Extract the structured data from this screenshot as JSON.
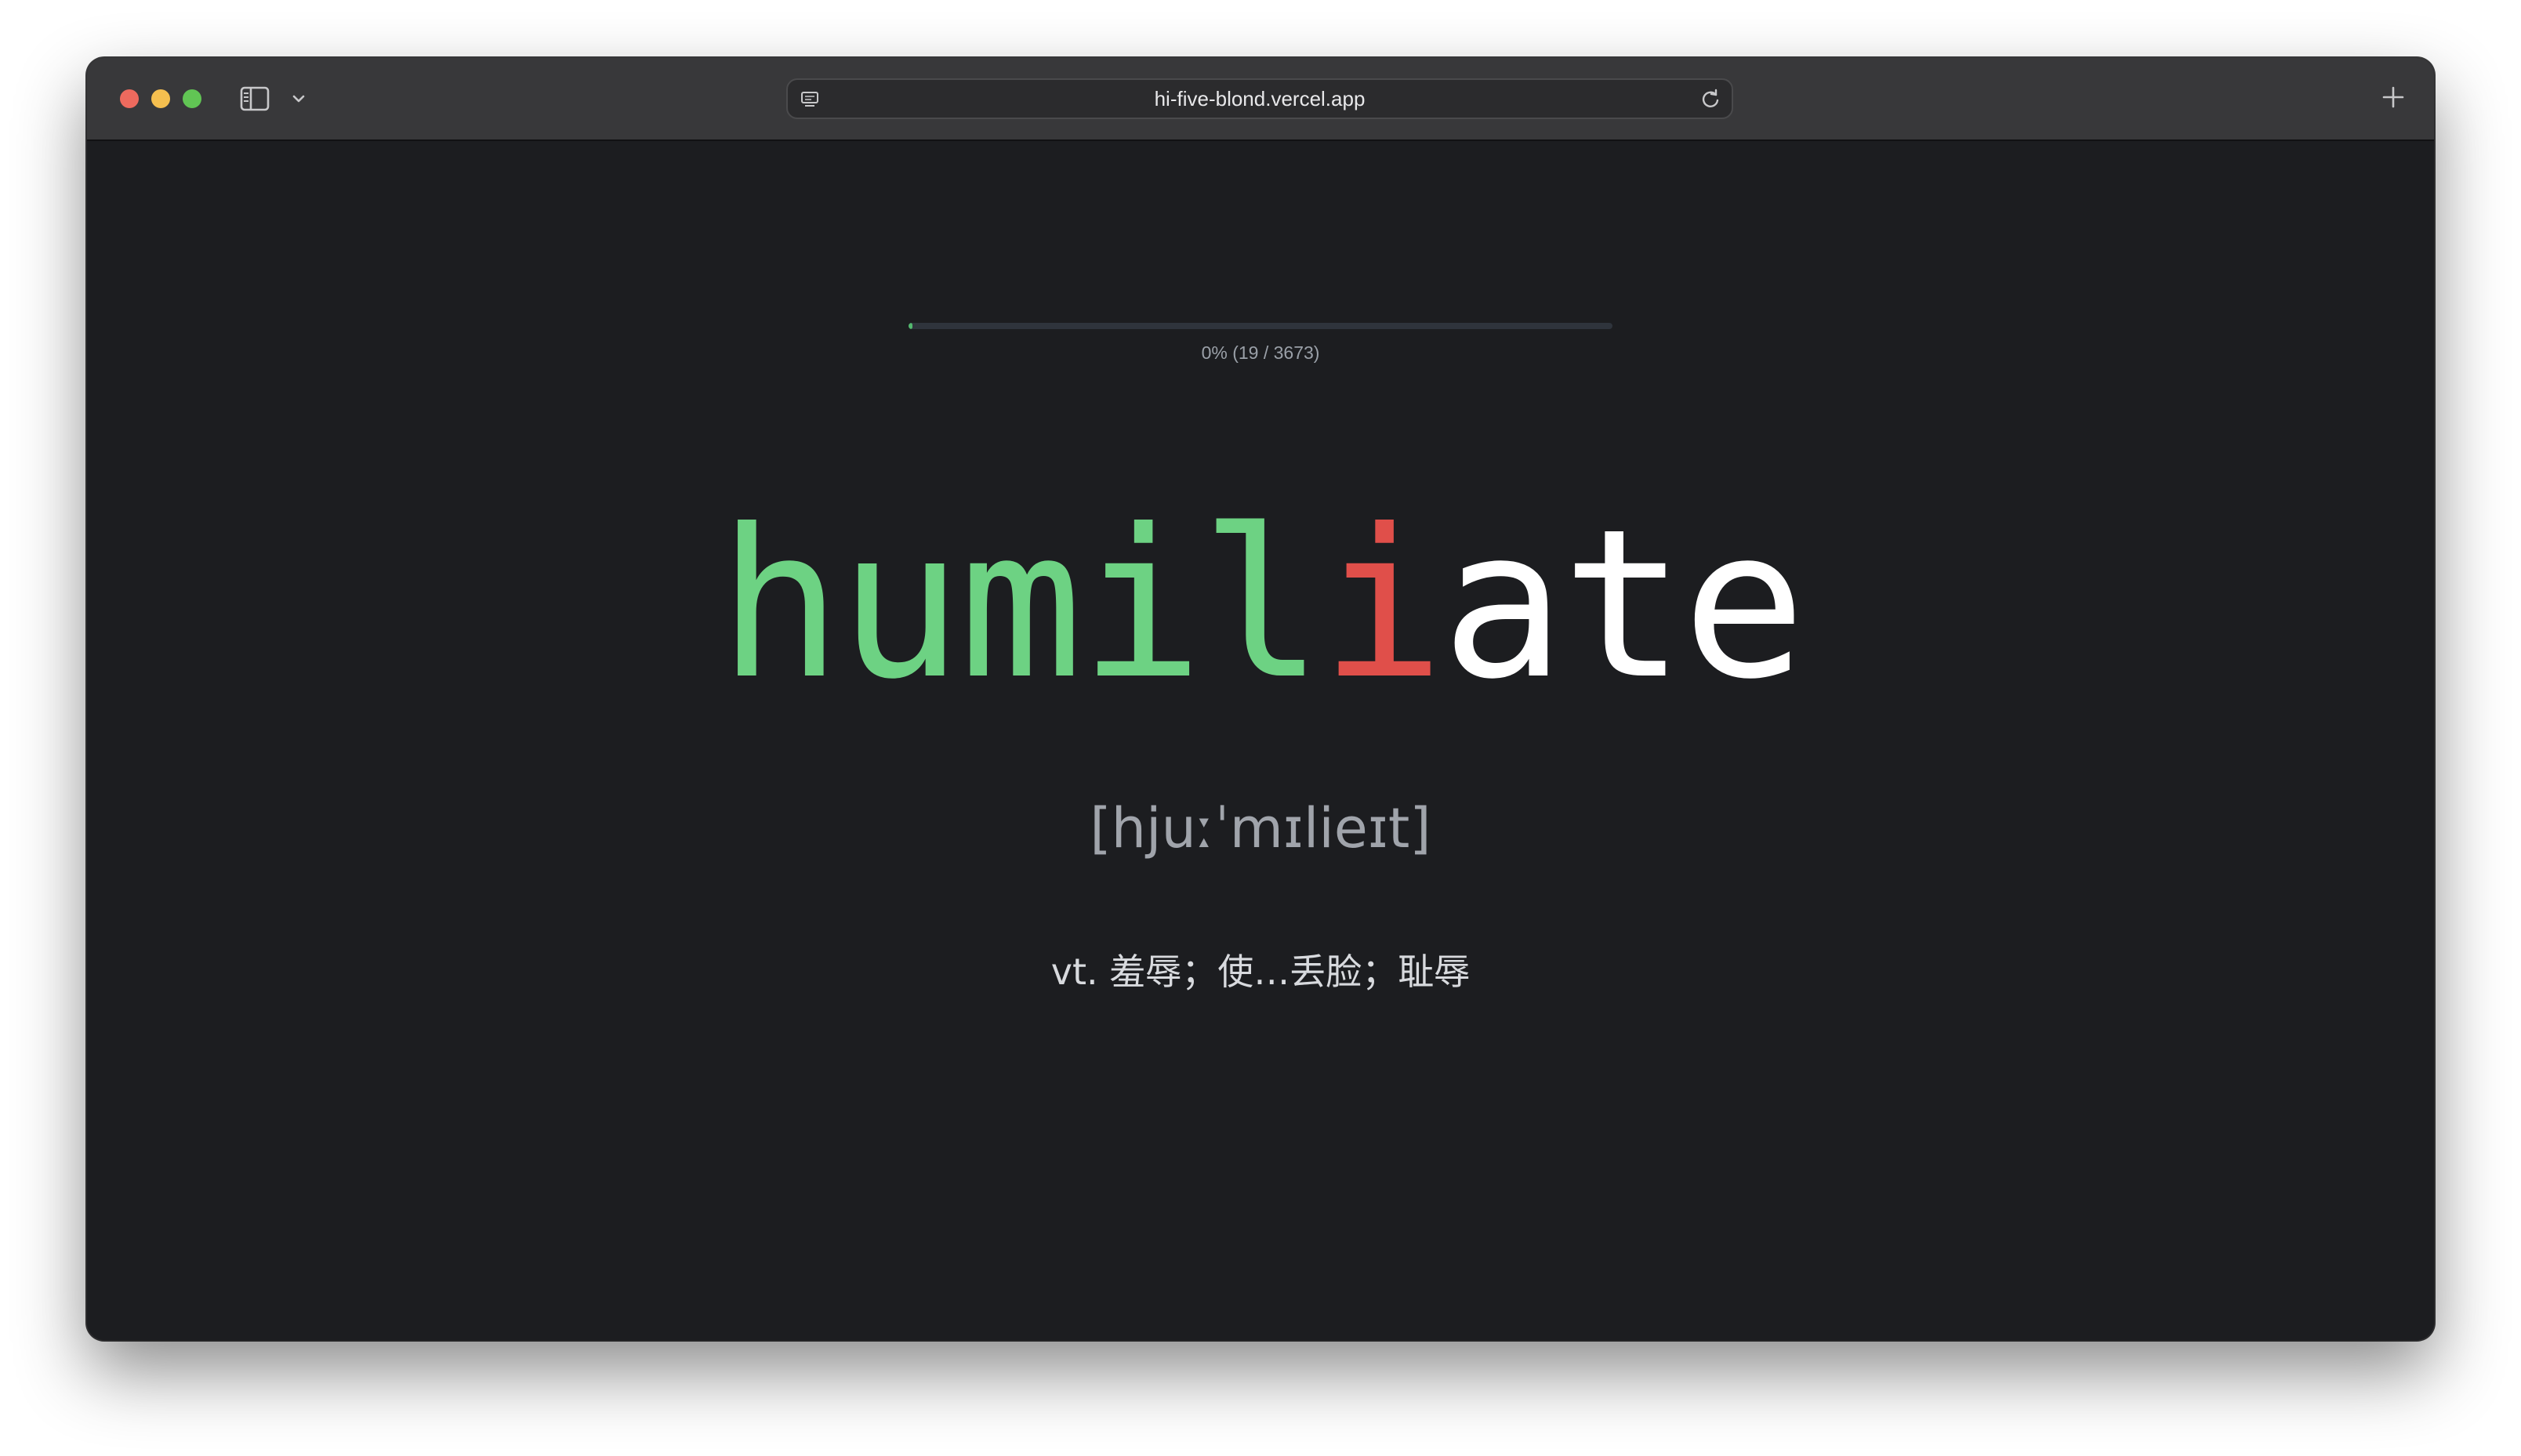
{
  "browser": {
    "url": "hi-five-blond.vercel.app"
  },
  "progress": {
    "label": "0% (19 / 3673)",
    "completed": 19,
    "total": 3673,
    "fraction": 0.0052
  },
  "word": {
    "letters": [
      {
        "char": "h",
        "state": "correct"
      },
      {
        "char": "u",
        "state": "correct"
      },
      {
        "char": "m",
        "state": "correct"
      },
      {
        "char": "i",
        "state": "correct"
      },
      {
        "char": "l",
        "state": "correct"
      },
      {
        "char": "i",
        "state": "wrong"
      },
      {
        "char": "a",
        "state": "pending"
      },
      {
        "char": "t",
        "state": "pending"
      },
      {
        "char": "e",
        "state": "pending"
      }
    ]
  },
  "phonetic": "[hjuːˈmɪlieɪt]",
  "definition": "vt. 羞辱；使…丢脸；耻辱",
  "colors": {
    "correct": "#6dd283",
    "wrong": "#e04f4a",
    "pending": "#ffffff",
    "background": "#1c1d20"
  },
  "icons": {
    "sidebar": "sidebar-icon",
    "chevron": "chevron-down-icon",
    "page": "page-icon",
    "reload": "reload-icon",
    "new_tab": "plus-icon"
  }
}
